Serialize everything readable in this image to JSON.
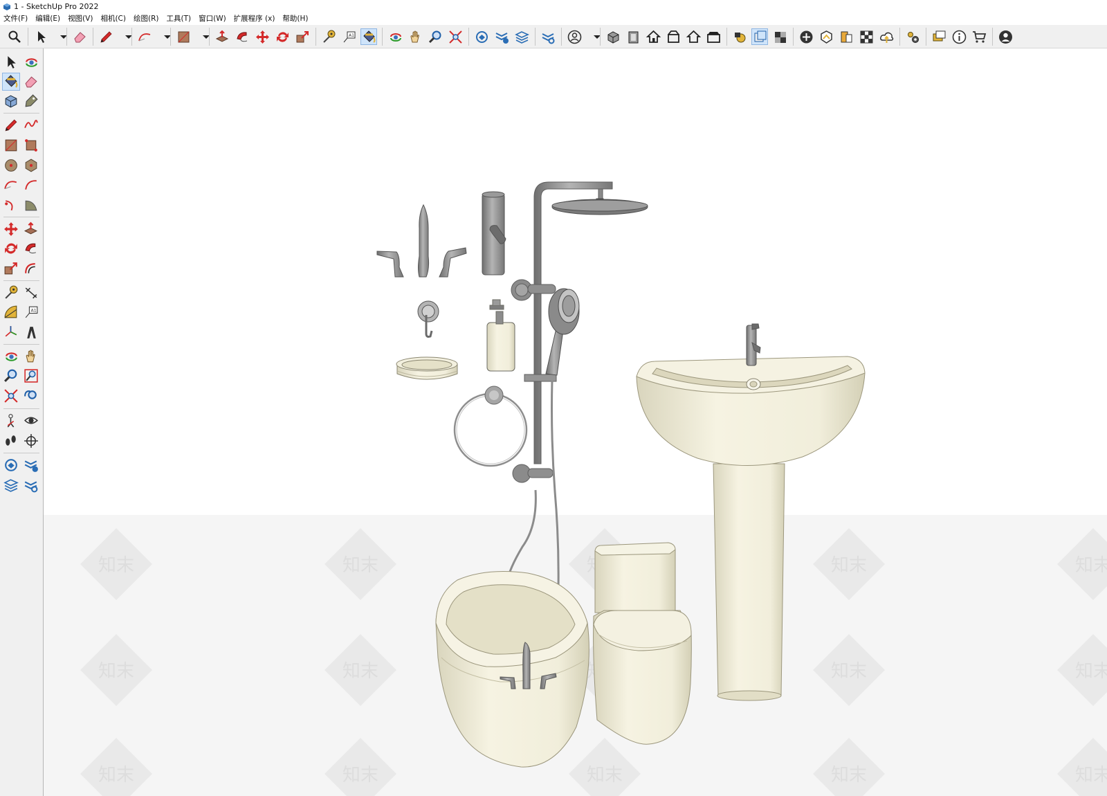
{
  "window": {
    "title": "1 - SketchUp Pro 2022"
  },
  "menu": {
    "items": [
      "文件(F)",
      "编辑(E)",
      "视图(V)",
      "相机(C)",
      "绘图(R)",
      "工具(T)",
      "窗口(W)",
      "扩展程序 (x)",
      "帮助(H)"
    ]
  },
  "toolbar": {
    "groups": [
      [
        "search-icon"
      ],
      [
        "select-icon",
        "dropdown-icon"
      ],
      [
        "eraser-icon"
      ],
      [
        "pencil-icon",
        "dropdown-icon"
      ],
      [
        "arc-icon",
        "dropdown-icon"
      ],
      [
        "rectangle-icon",
        "dropdown-icon"
      ],
      [
        "push-pull-icon",
        "follow-me-icon",
        "move-icon",
        "rotate-icon",
        "scale-icon"
      ],
      [
        "tape-measure-icon",
        "text-label-icon",
        "paint-bucket-icon"
      ],
      [
        "orbit-icon",
        "pan-icon",
        "zoom-icon",
        "zoom-extents-icon"
      ],
      [
        "warehouse-icon",
        "extension-warehouse-icon",
        "layout-icon"
      ],
      [
        "extension-manager-icon"
      ],
      [
        "account-icon",
        "dropdown-icon"
      ],
      [
        "iso-view-icon",
        "front-view-icon",
        "top-view-icon",
        "right-view-icon",
        "back-view-icon",
        "left-view-icon"
      ],
      [
        "model-info-icon",
        "components-icon",
        "materials-icon"
      ],
      [
        "add-location-icon",
        "terrain-icon",
        "photo-texture-icon",
        "checker-icon",
        "cloud-icon"
      ],
      [
        "settings-icon"
      ],
      [
        "chat-icon",
        "info-icon",
        "cart-icon"
      ],
      [
        "user-profile-icon"
      ]
    ]
  },
  "left_tools": [
    "select-icon",
    "orbit-icon",
    "paint-bucket-icon",
    "eraser-icon",
    "make-component-icon",
    "tag-icon",
    "pencil-icon",
    "freehand-icon",
    "rectangle-icon",
    "rotated-rectangle-icon",
    "circle-icon",
    "polygon-icon",
    "arc-icon",
    "two-point-arc-icon",
    "three-point-arc-icon",
    "pie-icon",
    "move-icon",
    "push-pull-icon",
    "rotate-icon",
    "follow-me-icon",
    "scale-icon",
    "offset-icon",
    "tape-measure-icon",
    "dimension-icon",
    "protractor-icon",
    "text-icon",
    "axes-icon",
    "3d-text-icon",
    "orbit-icon",
    "pan-icon",
    "zoom-icon",
    "zoom-window-icon",
    "zoom-extents-icon",
    "previous-view-icon",
    "position-camera-icon",
    "look-around-icon",
    "walk-icon",
    "section-plane-icon",
    "warehouse-icon",
    "extension-warehouse-icon",
    "layout-icon",
    "extension-manager-icon"
  ],
  "viewport": {
    "watermark_text": "知末",
    "scene_objects": [
      "faucet-set",
      "basin-faucet",
      "shower-column",
      "rain-shower-head",
      "hand-shower",
      "robe-hook",
      "soap-dispenser",
      "soap-dish",
      "towel-ring",
      "pedestal-sink",
      "toilet",
      "bathtub",
      "bathtub-faucet"
    ]
  },
  "colors": {
    "ceramic": "#efecd9",
    "metal": "#8e8e8e",
    "ground": "#f4f4f4",
    "watermark": "#e9e9e9",
    "active_tool": "#cfe4fa"
  }
}
